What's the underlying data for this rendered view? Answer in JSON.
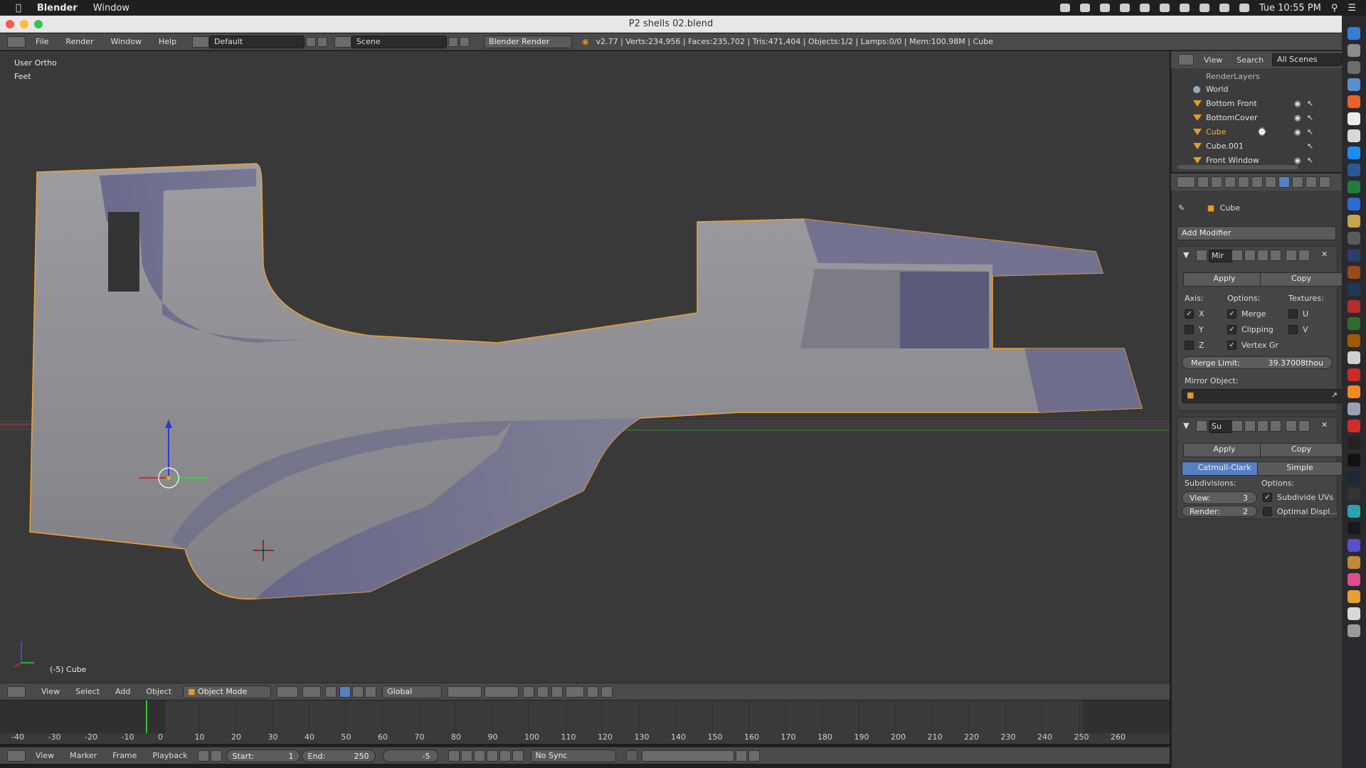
{
  "macbar": {
    "app_name": "Blender",
    "menu_window": "Window",
    "clock": "Tue 10:55 PM"
  },
  "window": {
    "title": "P2 shells 02.blend"
  },
  "info_header": {
    "menus": [
      "File",
      "Render",
      "Window",
      "Help"
    ],
    "layout": "Default",
    "scene": "Scene",
    "engine": "Blender Render",
    "stats": "v2.77 | Verts:234,956 | Faces:235,702 | Tris:471,404 | Objects:1/2 | Lamps:0/0 | Mem:100.98M | Cube"
  },
  "viewport": {
    "view_name": "User Ortho",
    "units": "Feet",
    "object_label": "(-5) Cube"
  },
  "view3d_header": {
    "menus": [
      "View",
      "Select",
      "Add",
      "Object"
    ],
    "mode": "Object Mode",
    "orientation": "Global"
  },
  "timeline": {
    "ticks": [
      "-40",
      "-30",
      "-20",
      "-10",
      "0",
      "10",
      "20",
      "30",
      "40",
      "50",
      "60",
      "70",
      "80",
      "90",
      "100",
      "110",
      "120",
      "130",
      "140",
      "150",
      "160",
      "170",
      "180",
      "190",
      "200",
      "210",
      "220",
      "230",
      "240",
      "250",
      "260"
    ],
    "menus": [
      "View",
      "Marker",
      "Frame",
      "Playback"
    ],
    "start_label": "Start:",
    "start_value": "1",
    "end_label": "End:",
    "end_value": "250",
    "current_frame": "-5",
    "sync": "No Sync"
  },
  "outliner": {
    "tabs": [
      "View",
      "Search"
    ],
    "scene_filter": "All Scenes",
    "items": [
      "RenderLayers",
      "World",
      "Bottom Front",
      "BottomCover",
      "Cube",
      "Cube.001",
      "Front Window"
    ]
  },
  "properties": {
    "object_name": "Cube",
    "add_modifier": "Add Modifier",
    "mirror": {
      "name": "Mir",
      "apply": "Apply",
      "copy": "Copy",
      "axis_label": "Axis:",
      "options_label": "Options:",
      "textures_label": "Textures:",
      "axes": [
        {
          "label": "X",
          "checked": true
        },
        {
          "label": "Y",
          "checked": false
        },
        {
          "label": "Z",
          "checked": false
        }
      ],
      "options": [
        {
          "label": "Merge",
          "checked": true
        },
        {
          "label": "Clipping",
          "checked": true
        },
        {
          "label": "Vertex Gr",
          "checked": true
        }
      ],
      "textures": [
        {
          "label": "U",
          "checked": false
        },
        {
          "label": "V",
          "checked": false
        }
      ],
      "merge_limit_label": "Merge Limit:",
      "merge_limit_value": "39.37008thou",
      "mirror_object_label": "Mirror Object:"
    },
    "subsurf": {
      "name": "Su",
      "apply": "Apply",
      "copy": "Copy",
      "type_active": "Catmull-Clark",
      "type_other": "Simple",
      "subdivisions_label": "Subdivisions:",
      "options_label": "Options:",
      "view_label": "View:",
      "view_value": "3",
      "render_label": "Render:",
      "render_value": "2",
      "subdivide_uvs": "Subdivide UVs",
      "optimal_display": "Optimal Displ..."
    }
  }
}
